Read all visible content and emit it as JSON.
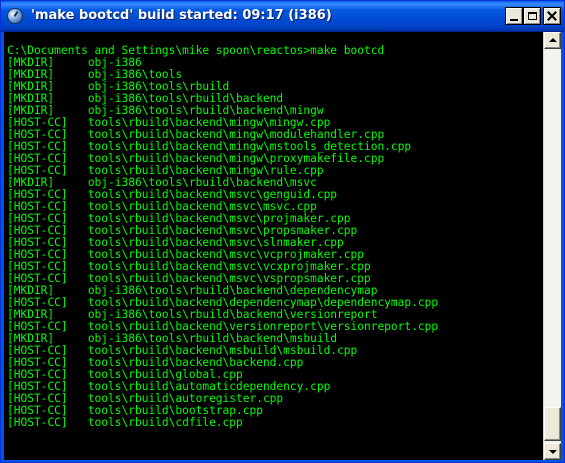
{
  "window": {
    "title": "'make bootcd' build started: 09:17   (i386)",
    "icon": "console-app-icon",
    "controls": {
      "minimize": "minimize-icon",
      "maximize": "maximize-icon",
      "close": "close-icon"
    }
  },
  "console": {
    "prompt": "C:\\Documents and Settings\\mike spoon\\reactos>make bootcd",
    "lines": [
      "[MKDIR]     obj-i386",
      "[MKDIR]     obj-i386\\tools",
      "[MKDIR]     obj-i386\\tools\\rbuild",
      "[MKDIR]     obj-i386\\tools\\rbuild\\backend",
      "[MKDIR]     obj-i386\\tools\\rbuild\\backend\\mingw",
      "[HOST-CC]   tools\\rbuild\\backend\\mingw\\mingw.cpp",
      "[HOST-CC]   tools\\rbuild\\backend\\mingw\\modulehandler.cpp",
      "[HOST-CC]   tools\\rbuild\\backend\\mingw\\mstools_detection.cpp",
      "[HOST-CC]   tools\\rbuild\\backend\\mingw\\proxymakefile.cpp",
      "[HOST-CC]   tools\\rbuild\\backend\\mingw\\rule.cpp",
      "[MKDIR]     obj-i386\\tools\\rbuild\\backend\\msvc",
      "[HOST-CC]   tools\\rbuild\\backend\\msvc\\genguid.cpp",
      "[HOST-CC]   tools\\rbuild\\backend\\msvc\\msvc.cpp",
      "[HOST-CC]   tools\\rbuild\\backend\\msvc\\projmaker.cpp",
      "[HOST-CC]   tools\\rbuild\\backend\\msvc\\propsmaker.cpp",
      "[HOST-CC]   tools\\rbuild\\backend\\msvc\\slnmaker.cpp",
      "[HOST-CC]   tools\\rbuild\\backend\\msvc\\vcprojmaker.cpp",
      "[HOST-CC]   tools\\rbuild\\backend\\msvc\\vcxprojmaker.cpp",
      "[HOST-CC]   tools\\rbuild\\backend\\msvc\\vspropsmaker.cpp",
      "[MKDIR]     obj-i386\\tools\\rbuild\\backend\\dependencymap",
      "[HOST-CC]   tools\\rbuild\\backend\\dependencymap\\dependencymap.cpp",
      "[MKDIR]     obj-i386\\tools\\rbuild\\backend\\versionreport",
      "[HOST-CC]   tools\\rbuild\\backend\\versionreport\\versionreport.cpp",
      "[MKDIR]     obj-i386\\tools\\rbuild\\backend\\msbuild",
      "[HOST-CC]   tools\\rbuild\\backend\\msbuild\\msbuild.cpp",
      "[HOST-CC]   tools\\rbuild\\backend\\backend.cpp",
      "[HOST-CC]   tools\\rbuild\\global.cpp",
      "[HOST-CC]   tools\\rbuild\\automaticdependency.cpp",
      "[HOST-CC]   tools\\rbuild\\autoregister.cpp",
      "[HOST-CC]   tools\\rbuild\\bootstrap.cpp",
      "[HOST-CC]   tools\\rbuild\\cdfile.cpp"
    ]
  },
  "scrollbar": {
    "up_icon": "scroll-up-arrow-icon",
    "down_icon": "scroll-down-arrow-icon",
    "position_fraction": 0.92
  },
  "colors": {
    "console_bg": "#000000",
    "console_text": "#00ff00",
    "titlebar": "#0055e5"
  }
}
